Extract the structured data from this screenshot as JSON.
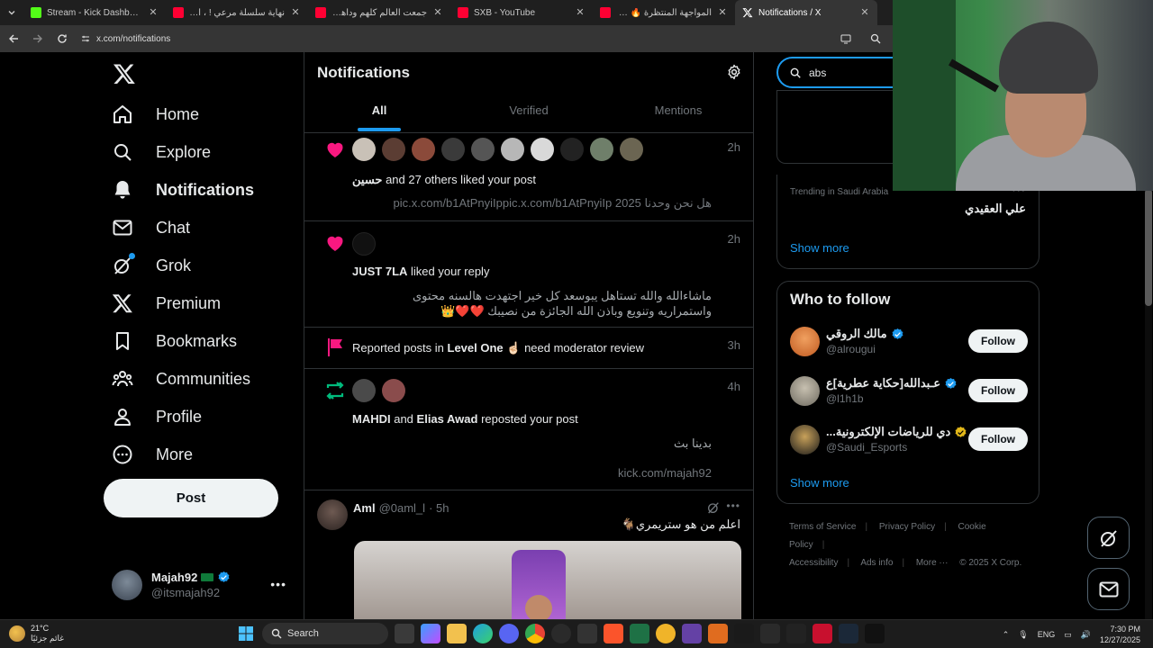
{
  "browser": {
    "tabs": [
      {
        "title": "Stream - Kick Dashboard",
        "icon": "kick-icon",
        "color": "#53fc18",
        "active": false
      },
      {
        "title": "نهاية سلسلة مرعي ! ، المواجهة ال",
        "icon": "youtube-icon",
        "color": "#ff0033",
        "active": false
      },
      {
        "title": "جمعت العالم كلهم وداهمت المد",
        "icon": "youtube-icon",
        "color": "#ff0033",
        "active": false
      },
      {
        "title": "SXB - YouTube",
        "icon": "youtube-icon",
        "color": "#ff0033",
        "active": false
      },
      {
        "title": "المواجهة المنتظرة 🔥 (فخ ...!!",
        "icon": "youtube-icon",
        "color": "#ff0033",
        "active": false
      },
      {
        "title": "Notifications / X",
        "icon": "x-icon",
        "color": "#ffffff",
        "active": true
      }
    ],
    "url": "x.com/notifications"
  },
  "nav": {
    "items": [
      {
        "label": "Home",
        "icon": "home-icon"
      },
      {
        "label": "Explore",
        "icon": "search-icon"
      },
      {
        "label": "Notifications",
        "icon": "bell-icon"
      },
      {
        "label": "Chat",
        "icon": "mail-icon"
      },
      {
        "label": "Grok",
        "icon": "grok-icon"
      },
      {
        "label": "Premium",
        "icon": "x-logo-icon"
      },
      {
        "label": "Bookmarks",
        "icon": "bookmark-icon"
      },
      {
        "label": "Communities",
        "icon": "communities-icon"
      },
      {
        "label": "Profile",
        "icon": "profile-icon"
      },
      {
        "label": "More",
        "icon": "more-icon"
      }
    ],
    "post_label": "Post",
    "account": {
      "name": "Majah92",
      "handle": "@itsmajah92"
    }
  },
  "feed": {
    "title": "Notifications",
    "tabs": [
      "All",
      "Verified",
      "Mentions"
    ],
    "n1": {
      "time": "2h",
      "actor": "حسين",
      "text": " and 27 others liked your post",
      "sub": "هل نحن وحدنا 2025 pic.x.com/b1AtPnyiIppic.x.com/b1AtPnyiIp"
    },
    "n2": {
      "time": "2h",
      "actor": "JUST 7LA",
      "text": " liked your reply",
      "sub": "ماشاءالله والله تستاهل يبوسعد كل خير اجتهدت هالسنه محتوى واستمراريه وتنويع وباذن الله الجائزة من نصيبك ❤️❤️👑"
    },
    "n3": {
      "time": "3h",
      "pre": "Reported posts in ",
      "community": "Level One",
      "post": " ☝🏻 need moderator review"
    },
    "n4": {
      "time": "4h",
      "actor1": "MAHDI",
      "and": " and ",
      "actor2": "Elias Awad",
      "text": " reposted your post",
      "sub1": "بدينا بث",
      "sub2": "kick.com/majah92"
    },
    "tweet": {
      "name": "Aml",
      "handle": "@0aml_l",
      "time": "· 5h",
      "text": "اعلم من هو ستريمري🐐"
    }
  },
  "right": {
    "search_value": "abs",
    "trend": {
      "label": "Trending in Saudi Arabia",
      "name": "علي العقيدي",
      "show_more": "Show more"
    },
    "who_to_follow": {
      "title": "Who to follow",
      "users": [
        {
          "name": "مالك الروقي",
          "handle": "@alrougui",
          "verified": "blue",
          "follow": "Follow"
        },
        {
          "name": "عـبدالله[حكاية عطرية]ع",
          "handle": "@l1h1b",
          "verified": "blue",
          "follow": "Follow"
        },
        {
          "name": "...دي للرياضات الإلكترونية",
          "handle": "@Saudi_Esports",
          "verified": "gold",
          "follow": "Follow"
        }
      ],
      "show_more": "Show more"
    },
    "footer": [
      "Terms of Service",
      "Privacy Policy",
      "Cookie Policy",
      "Accessibility",
      "Ads info",
      "More ···",
      "© 2025 X Corp."
    ]
  },
  "taskbar": {
    "weather_temp": "21°C",
    "weather_desc": "غائم جزئيًا",
    "search_label": "Search",
    "lang": "ENG",
    "time": "7:30 PM",
    "date": "12/27/2025"
  },
  "colors": {
    "accent": "#1d9bf0",
    "like": "#f91880",
    "repost": "#00ba7c",
    "background": "#000000"
  }
}
